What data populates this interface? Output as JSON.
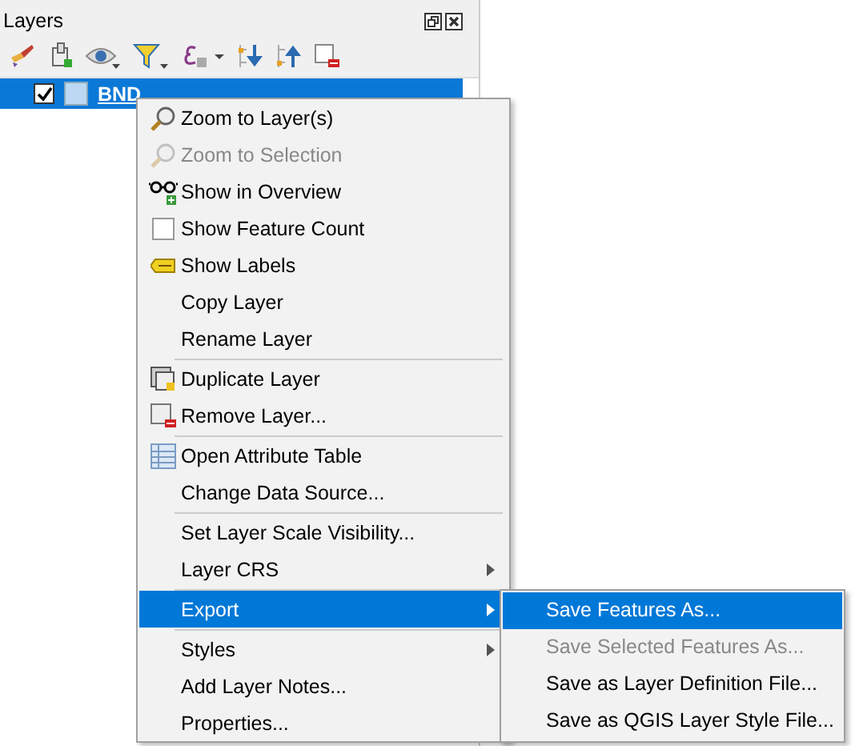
{
  "panel": {
    "title": "Layers"
  },
  "layer": {
    "name": "BND",
    "checked": true,
    "selected": true
  },
  "menu": [
    {
      "kind": "item",
      "label": "Zoom to Layer(s)",
      "disabled": false,
      "submenu": false,
      "selected": false
    },
    {
      "kind": "item",
      "label": "Zoom to Selection",
      "disabled": true,
      "submenu": false,
      "selected": false
    },
    {
      "kind": "item",
      "label": "Show in Overview",
      "disabled": false,
      "submenu": false,
      "selected": false
    },
    {
      "kind": "checkbox",
      "label": "Show Feature Count",
      "checked": false,
      "disabled": false,
      "submenu": false,
      "selected": false
    },
    {
      "kind": "item",
      "label": "Show Labels",
      "disabled": false,
      "submenu": false,
      "selected": false
    },
    {
      "kind": "item",
      "label": "Copy Layer",
      "disabled": false,
      "submenu": false,
      "selected": false
    },
    {
      "kind": "item",
      "label": "Rename Layer",
      "disabled": false,
      "submenu": false,
      "selected": false
    },
    {
      "kind": "separator"
    },
    {
      "kind": "item",
      "label": "Duplicate Layer",
      "disabled": false,
      "submenu": false,
      "selected": false
    },
    {
      "kind": "item",
      "label": "Remove Layer...",
      "disabled": false,
      "submenu": false,
      "selected": false
    },
    {
      "kind": "separator"
    },
    {
      "kind": "item",
      "label": "Open Attribute Table",
      "disabled": false,
      "submenu": false,
      "selected": false
    },
    {
      "kind": "item",
      "label": "Change Data Source...",
      "disabled": false,
      "submenu": false,
      "selected": false
    },
    {
      "kind": "separator"
    },
    {
      "kind": "item",
      "label": "Set Layer Scale Visibility...",
      "disabled": false,
      "submenu": false,
      "selected": false
    },
    {
      "kind": "item",
      "label": "Layer CRS",
      "disabled": false,
      "submenu": true,
      "selected": false
    },
    {
      "kind": "separator"
    },
    {
      "kind": "item",
      "label": "Export",
      "disabled": false,
      "submenu": true,
      "selected": true
    },
    {
      "kind": "separator"
    },
    {
      "kind": "item",
      "label": "Styles",
      "disabled": false,
      "submenu": true,
      "selected": false
    },
    {
      "kind": "item",
      "label": "Add Layer Notes...",
      "disabled": false,
      "submenu": false,
      "selected": false
    },
    {
      "kind": "item",
      "label": "Properties...",
      "disabled": false,
      "submenu": false,
      "selected": false
    }
  ],
  "submenu": [
    {
      "label": "Save Features As...",
      "disabled": false,
      "selected": true
    },
    {
      "label": "Save Selected Features As...",
      "disabled": true,
      "selected": false
    },
    {
      "label": "Save as Layer Definition File...",
      "disabled": false,
      "selected": false
    },
    {
      "label": "Save as QGIS Layer Style File...",
      "disabled": false,
      "selected": false
    }
  ]
}
